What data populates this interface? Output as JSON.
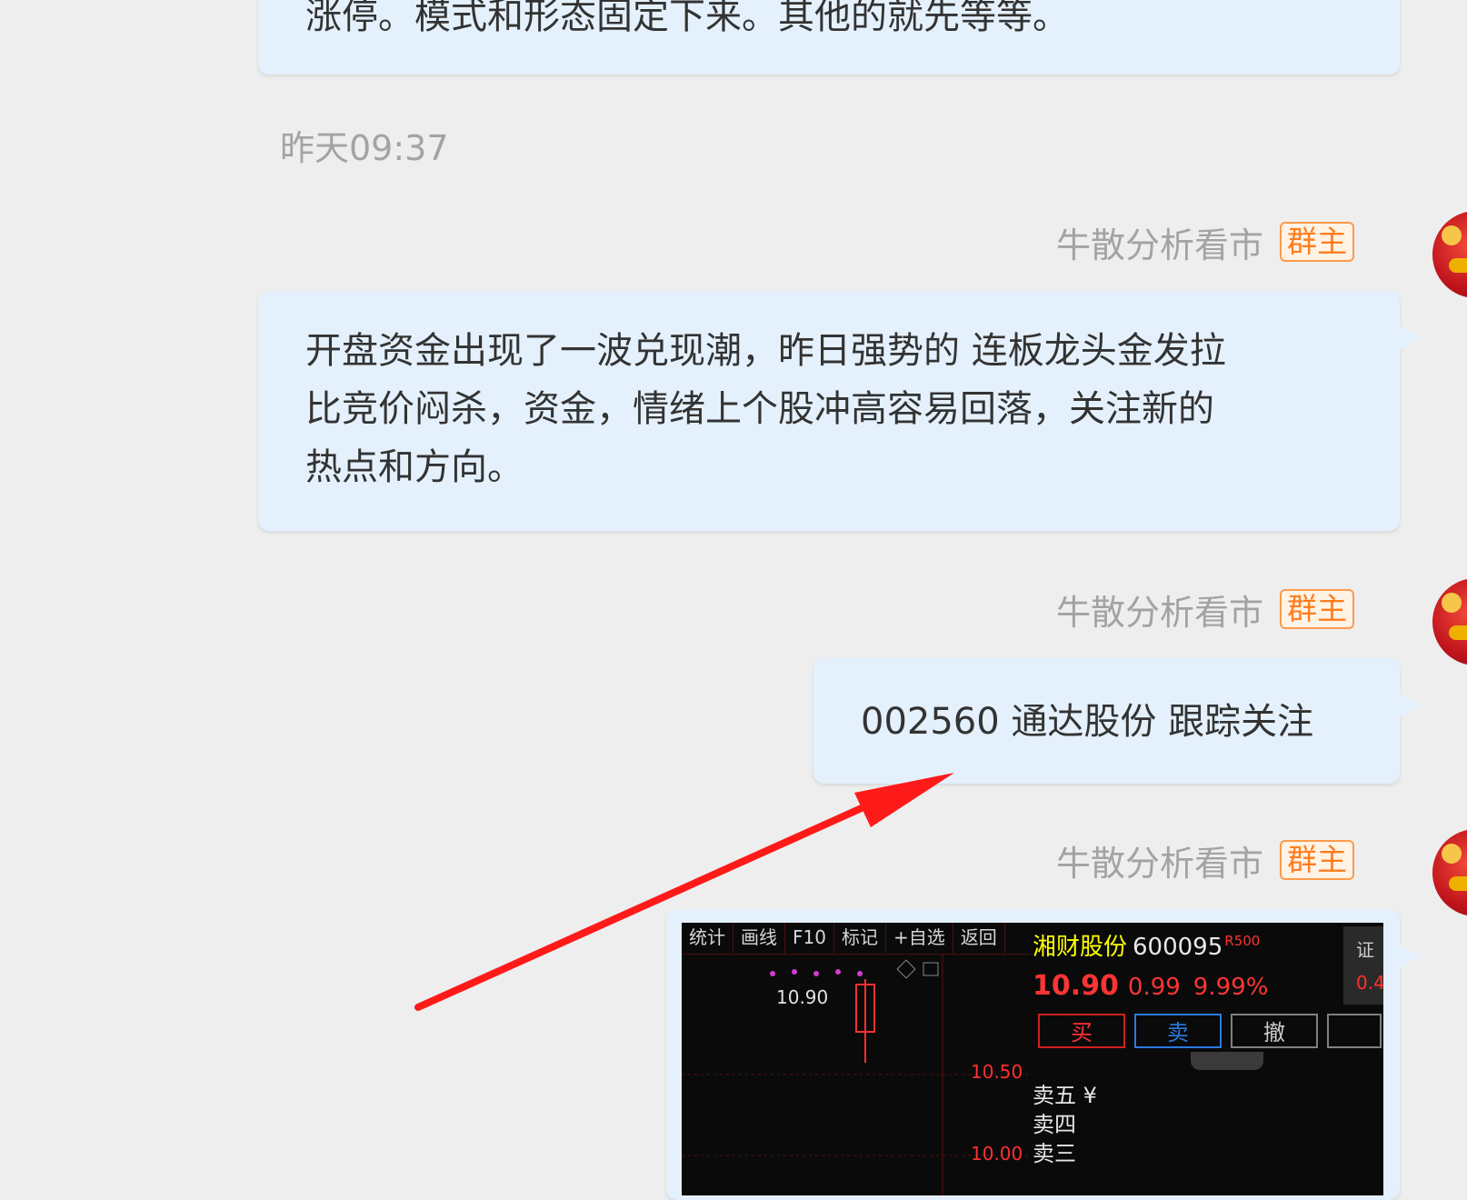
{
  "messages": {
    "top_partial_text": "涨停。模式和形态固定下来。其他的就先等等。",
    "timestamp": "昨天09:37",
    "sender_name": "牛散分析看市",
    "role_badge": "群主",
    "msg1_line1": "开盘资金出现了一波兑现潮，昨日强势的 连板龙头金发拉",
    "msg1_line2": "比竞价闷杀，资金，情绪上个股冲高容易回落，关注新的",
    "msg1_line3": "热点和方向。",
    "msg2_text": "002560 通达股份 跟踪关注"
  },
  "stock_screenshot": {
    "toolbar": [
      "统计",
      "画线",
      "F10",
      "标记",
      "+自选",
      "返回"
    ],
    "stock_name": "湘财股份",
    "stock_code": "600095",
    "stock_tag": "R500",
    "price": "10.90",
    "change": "0.99",
    "change_pct": "9.99%",
    "side_top": "证",
    "side_bottom": "0.4",
    "buttons": [
      "买",
      "卖",
      "撤"
    ],
    "sell_levels": [
      "卖五 ¥",
      "卖四",
      "卖三"
    ],
    "chart_price_label": "10.90",
    "axis_labels": [
      "10.50",
      "10.00"
    ]
  },
  "colors": {
    "bubble": "#e4f1fc",
    "annotation_arrow": "#ff1a1a",
    "stock_up": "#ff3434"
  }
}
